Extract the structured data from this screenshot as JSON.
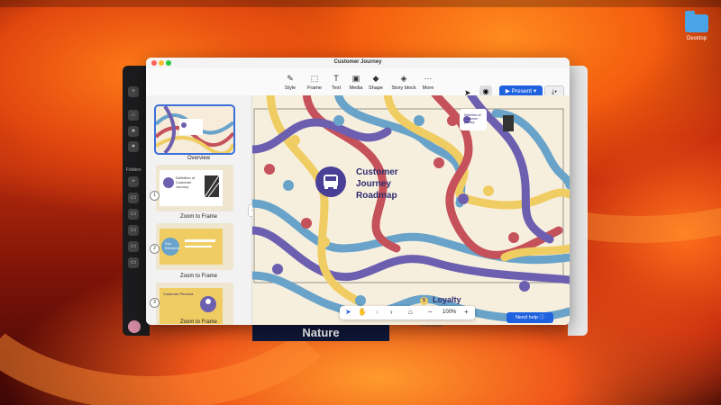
{
  "desktop": {
    "folder_label": "Desktop"
  },
  "window": {
    "title": "Customer Journey"
  },
  "toolbar": {
    "tools": [
      {
        "label": "Style",
        "icon": "pen-icon"
      },
      {
        "label": "Frame",
        "icon": "frame-icon"
      },
      {
        "label": "Text",
        "icon": "text-icon"
      },
      {
        "label": "Media",
        "icon": "image-icon"
      },
      {
        "label": "Shape",
        "icon": "shape-icon"
      },
      {
        "label": "Story block",
        "icon": "layers-icon"
      },
      {
        "label": "More",
        "icon": "ellipsis-icon"
      }
    ],
    "present_label": "Present"
  },
  "sidebar": {
    "folders_label": "Folders",
    "items": [
      {
        "num": "",
        "caption": "Overview"
      },
      {
        "num": "1",
        "caption": "Zoom to Frame",
        "title": "Definition of Customer Journey"
      },
      {
        "num": "2",
        "caption": "Zoom to Frame",
        "title": "Key Elements"
      },
      {
        "num": "3",
        "caption": "Zoom to Frame",
        "title": "Customer Persona"
      }
    ]
  },
  "canvas": {
    "title_line1": "Customer",
    "title_line2": "Journey",
    "title_line3": "Roadmap",
    "node_title": "Definition of Customer journey",
    "loyalty_label": "Loyalty",
    "loyalty_num": "5"
  },
  "bottombar": {
    "zoom": "100%"
  },
  "help_label": "Need help",
  "background_window": {
    "banner": "Nature",
    "subtext": "Practices"
  },
  "colors": {
    "present_blue": "#1f62e0",
    "road_blue": "#6aa3c9",
    "road_red": "#c5525a",
    "road_yellow": "#f0cd63",
    "road_purple": "#6d5fb0",
    "canvas_bg": "#f7efde"
  }
}
